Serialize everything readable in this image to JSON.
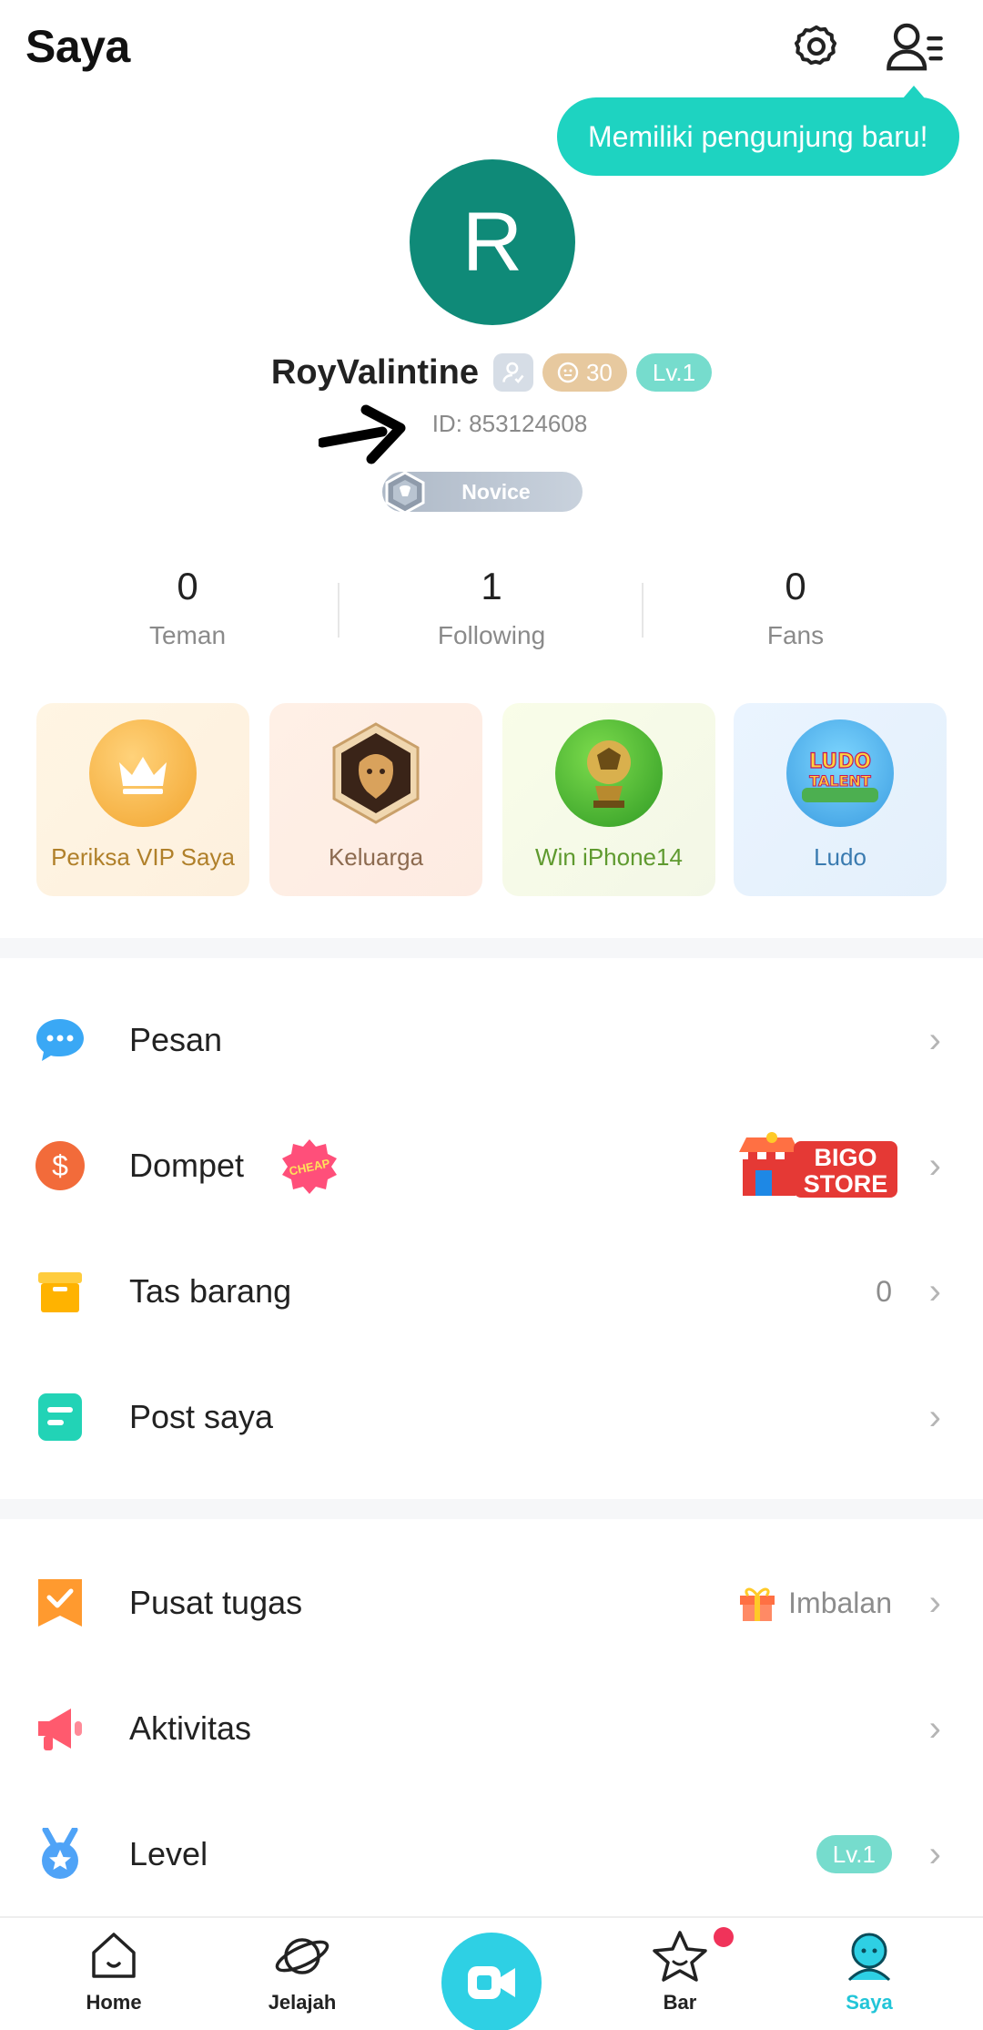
{
  "header": {
    "title": "Saya",
    "tooltip": "Memiliki pengunjung baru!"
  },
  "profile": {
    "avatar_letter": "R",
    "name": "RoyValintine",
    "coin_count": "30",
    "level_badge": "Lv.1",
    "id_text": "ID: 853124608",
    "rank": "Novice"
  },
  "stats": [
    {
      "value": "0",
      "label": "Teman"
    },
    {
      "value": "1",
      "label": "Following"
    },
    {
      "value": "0",
      "label": "Fans"
    }
  ],
  "cards": [
    {
      "label": "Periksa VIP Saya",
      "color": "#b0802a"
    },
    {
      "label": "Keluarga",
      "color": "#8c6a4f"
    },
    {
      "label": "Win iPhone14",
      "color": "#5f9a2f"
    },
    {
      "label": "Ludo",
      "color": "#3a7bb0"
    }
  ],
  "menu_section_1": [
    {
      "label": "Pesan",
      "right": ""
    },
    {
      "label": "Dompet",
      "badge": "CHEAP",
      "right_logo_line1": "BIGO",
      "right_logo_line2": "STORE"
    },
    {
      "label": "Tas barang",
      "right": "0"
    },
    {
      "label": "Post saya",
      "right": ""
    }
  ],
  "menu_section_2": [
    {
      "label": "Pusat tugas",
      "right": "Imbalan"
    },
    {
      "label": "Aktivitas",
      "right": ""
    },
    {
      "label": "Level",
      "right": "Lv.1"
    }
  ],
  "chevron": "›",
  "nav": {
    "home": "Home",
    "jelajah": "Jelajah",
    "bar": "Bar",
    "saya": "Saya"
  },
  "colors": {
    "accent": "#1ed3c1",
    "avatar_bg": "#0f8a78",
    "nav_active": "#22c5d8"
  }
}
